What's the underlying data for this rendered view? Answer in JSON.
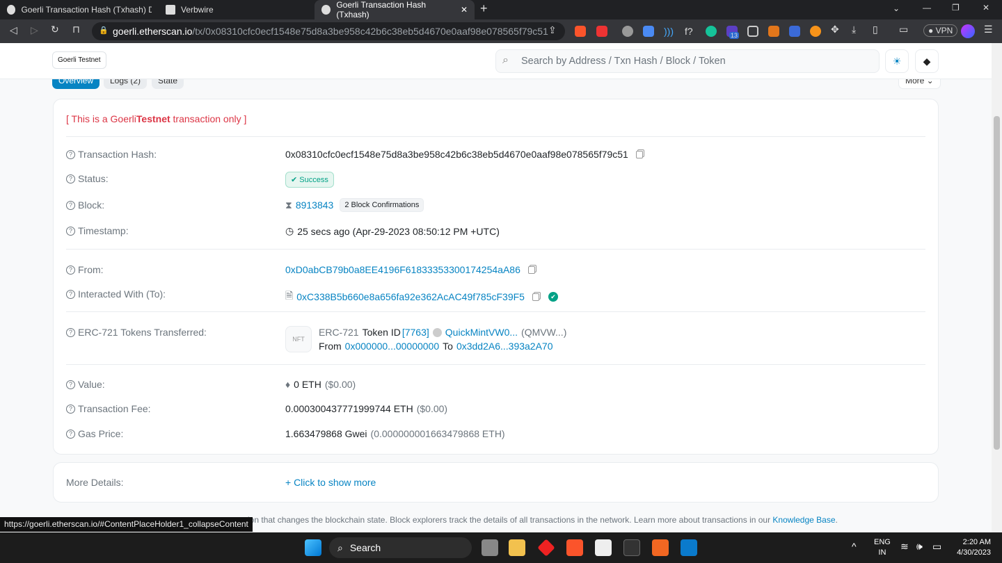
{
  "browser": {
    "tabs": [
      {
        "title": "Goerli Transaction Hash (Txhash) Detai"
      },
      {
        "title": "Verbwire"
      },
      {
        "title": "Goerli Transaction Hash (Txhash)"
      }
    ],
    "url_host": "goerli.etherscan.io",
    "url_path": "/tx/0x08310cfc0ecf1548e75d8a3be958c42b6c38eb5d4670e0aaf98e078565f79c51",
    "vpn": "VPN",
    "ext_badge": "13"
  },
  "header": {
    "network": "Goerli Testnet",
    "search_placeholder": "Search by Address / Txn Hash / Block / Token"
  },
  "tabs": {
    "overview": "Overview",
    "logs": "Logs (2)",
    "state": "State",
    "more": "More"
  },
  "notice": {
    "prefix": "[ This is a Goerli ",
    "bold": "Testnet",
    "suffix": " transaction only ]"
  },
  "tx": {
    "hash_label": "Transaction Hash:",
    "hash": "0x08310cfc0ecf1548e75d8a3be958c42b6c38eb5d4670e0aaf98e078565f79c51",
    "status_label": "Status:",
    "status": "Success",
    "block_label": "Block:",
    "block": "8913843",
    "confirmations": "2 Block Confirmations",
    "timestamp_label": "Timestamp:",
    "timestamp": "25 secs ago (Apr-29-2023 08:50:12 PM +UTC)",
    "from_label": "From:",
    "from": "0xD0abCB79b0a8EE4196F61833353300174254aA86",
    "to_label": "Interacted With (To):",
    "to": "0xC338B5b660e8a656fa92e362AcAC49f785cF39F5",
    "erc_label": "ERC-721 Tokens Transferred:",
    "erc_type": "ERC-721",
    "token_id_label": "Token ID",
    "token_id": "[7763]",
    "token_name": "QuickMintVW0...",
    "token_symbol": "(QMVW...)",
    "from_word": "From",
    "erc_from": "0x000000...00000000",
    "to_word": "To",
    "erc_to": "0x3dd2A6...393a2A70",
    "nft_icon": "NFT",
    "value_label": "Value:",
    "value": "0 ETH",
    "value_usd": "($0.00)",
    "fee_label": "Transaction Fee:",
    "fee": "0.000300437771999744 ETH",
    "fee_usd": "($0.00)",
    "gas_label": "Gas Price:",
    "gas": "1.663479868 Gwei",
    "gas_eth": "(0.000000001663479868 ETH)"
  },
  "more": {
    "label": "More Details:",
    "link": "+ Click to show more"
  },
  "footer": {
    "text": "uction that changes the blockchain state. Block explorers track the details of all transactions in the network. Learn more about transactions in our ",
    "link": "Knowledge Base",
    "end": "."
  },
  "status_url": "https://goerli.etherscan.io/#ContentPlaceHolder1_collapseContent",
  "taskbar": {
    "search": "Search",
    "lang1": "ENG",
    "lang2": "IN",
    "time": "2:20 AM",
    "date": "4/30/2023"
  }
}
